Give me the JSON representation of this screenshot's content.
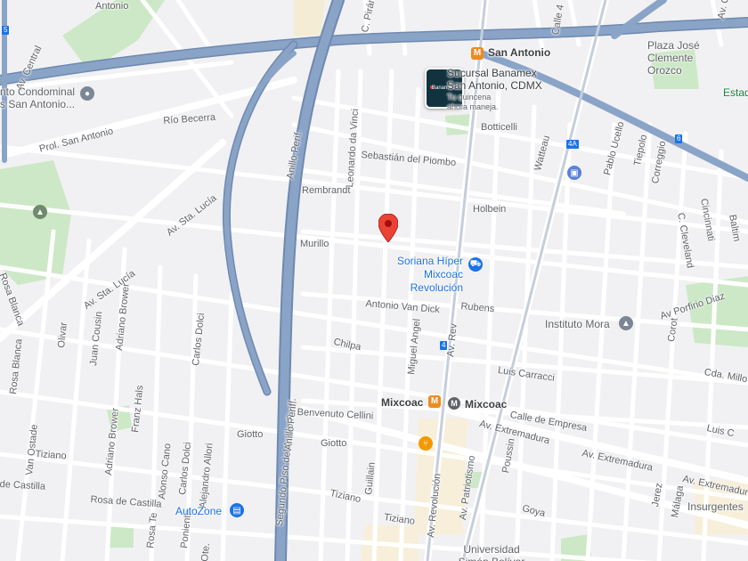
{
  "map": {
    "pin_icon": "red-location-pin",
    "colors": {
      "road": "#ffffff",
      "highway": "#8aa4c8",
      "highway_casing": "#6f89b0",
      "park": "#cde8c6",
      "water": "#aadaff",
      "land": "#f1f1f3",
      "pin": "#ea4335"
    },
    "road_labels": [
      "Antonio",
      "Av. Central",
      "Prol. San Antonio",
      "Río Becerra",
      "Anillo Perif.",
      "Leonardo da Vinci",
      "C. Piráme",
      "Calle 4",
      "Sebastián del Piombo",
      "Rembrandt",
      "Holbein",
      "Botticelli",
      "Watteau",
      "Pablo Ucello",
      "Tiepolo",
      "Correggio",
      "C. Cleveland",
      "Cincinnati",
      "Baltim",
      "Av. Sta. Lucía",
      "Av. Sta. Lucía",
      "Murillo",
      "Rubens",
      "Antonio Van Dick",
      "Chilpa",
      "Miguel Angel",
      "Av Porfirio Diaz",
      "Corot",
      "Luis Carracci",
      "Cda. Millo",
      "Benvenuto Cellini",
      "Giotto",
      "Giotto",
      "Calle de Empresa",
      "Av. Extremadura",
      "Av. Extremadura",
      "Av. Extremadura",
      "Luis C",
      "Segundo Piso del Anillo Perif.",
      "Anillo Perif.",
      "Olivar",
      "Juan Cousin",
      "Adriano Brower",
      "Carlos Dolci",
      "Rosa Blanca",
      "Franz Hals",
      "Adriano Brower",
      "Van Ostade",
      "Tiziano",
      "de Castilla",
      "Rosa de Castilla",
      "Alonso Cano",
      "Carlos Dolci",
      "Alejandro Allori",
      "Poniente",
      "Rosa Te",
      "Guillain",
      "Tiziano",
      "Tiziano",
      "Av. Revolución",
      "Av. Patriotismo",
      "Poussin",
      "Goya",
      "Jerez",
      "Málaga",
      "Insurgentes",
      "Ote.",
      "Rosa Blanca",
      "Av. Central",
      "Av. Rev"
    ],
    "pois": {
      "san_antonio_metro": "San Antonio",
      "plaza": "Plaza José Clemente Orozco",
      "estadio": "Estad",
      "condominal": "nto Condominal s San Antonio...",
      "banamex_title": "Sucursal Banamex San Antonio, CDMX",
      "banamex_sub": "Tu quincena ahora maneja.",
      "banamex_card": "Banamex",
      "soriana": "Soriana Híper Mixcoac Revolución",
      "instituto": "Instituto Mora",
      "mixcoac_metro": "Mixcoac",
      "mixcoac_m": "Mixcoac",
      "autozone": "AutoZone",
      "universidad": "Universidad Simón Bolívar"
    },
    "shields": [
      "5",
      "4A",
      "6",
      "4"
    ]
  }
}
